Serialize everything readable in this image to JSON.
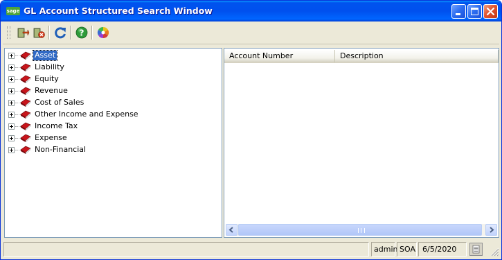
{
  "window": {
    "title": "GL Account Structured Search Window",
    "app_icon_text": "sage",
    "title_bar_color": "#0054e3",
    "controls": [
      "minimize-icon",
      "maximize-icon",
      "close-icon"
    ]
  },
  "toolbar": {
    "items": [
      {
        "name": "select-account-icon"
      },
      {
        "name": "clear-account-icon"
      },
      {
        "name": "refresh-icon"
      },
      {
        "name": "help-icon"
      },
      {
        "name": "color-wheel-icon"
      }
    ]
  },
  "tree": {
    "selected": "Asset",
    "items": [
      {
        "label": "Asset",
        "icon": "account-book-icon"
      },
      {
        "label": "Liability",
        "icon": "account-book-icon"
      },
      {
        "label": "Equity",
        "icon": "account-book-icon"
      },
      {
        "label": "Revenue",
        "icon": "account-book-icon"
      },
      {
        "label": "Cost of Sales",
        "icon": "account-book-icon"
      },
      {
        "label": "Other Income and Expense",
        "icon": "account-book-icon"
      },
      {
        "label": "Income Tax",
        "icon": "account-book-icon"
      },
      {
        "label": "Expense",
        "icon": "account-book-icon"
      },
      {
        "label": "Non-Financial",
        "icon": "account-book-icon"
      }
    ]
  },
  "grid": {
    "columns": [
      "Account Number",
      "Description"
    ],
    "rows": []
  },
  "statusbar": {
    "message": "",
    "user": "admin",
    "company": "SOA",
    "date": "6/5/2020"
  }
}
